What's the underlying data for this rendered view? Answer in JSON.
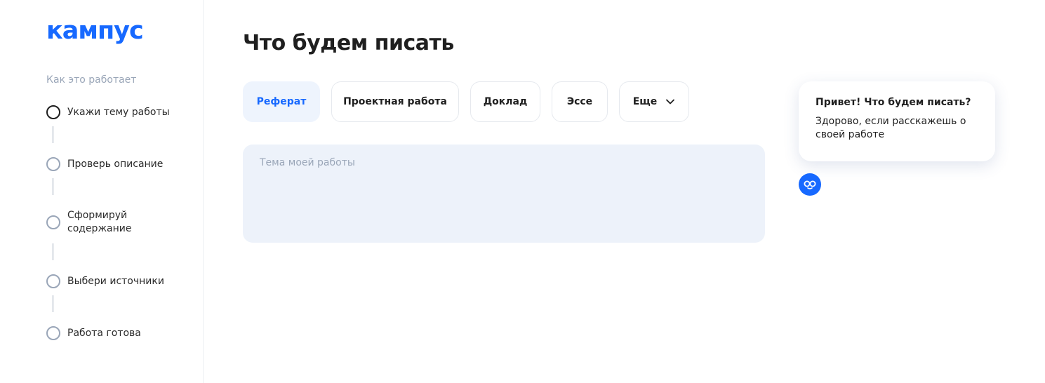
{
  "brand": {
    "logo": "кампус",
    "color": "#1769ff"
  },
  "sidebar": {
    "title": "Как это работает",
    "steps": [
      {
        "label": "Укажи тему работы",
        "state": "active"
      },
      {
        "label": "Проверь описание",
        "state": "pending"
      },
      {
        "label": "Сформируй содержание",
        "state": "pending"
      },
      {
        "label": "Выбери источники",
        "state": "pending"
      },
      {
        "label": "Работа готова",
        "state": "pending"
      }
    ]
  },
  "main": {
    "title": "Что будем писать",
    "tabs": [
      {
        "label": "Реферат",
        "active": true
      },
      {
        "label": "Проектная работа",
        "active": false
      },
      {
        "label": "Доклад",
        "active": false
      },
      {
        "label": "Эссе",
        "active": false
      },
      {
        "label": "Еще",
        "active": false,
        "icon": "chevron-down-icon"
      }
    ],
    "topic_input": {
      "placeholder": "Тема моей работы",
      "value": ""
    }
  },
  "assistant": {
    "greeting": "Привет! Что будем писать?",
    "message": "Здорово, если расскажешь о своей работе",
    "icon": "bot-avatar-icon"
  }
}
